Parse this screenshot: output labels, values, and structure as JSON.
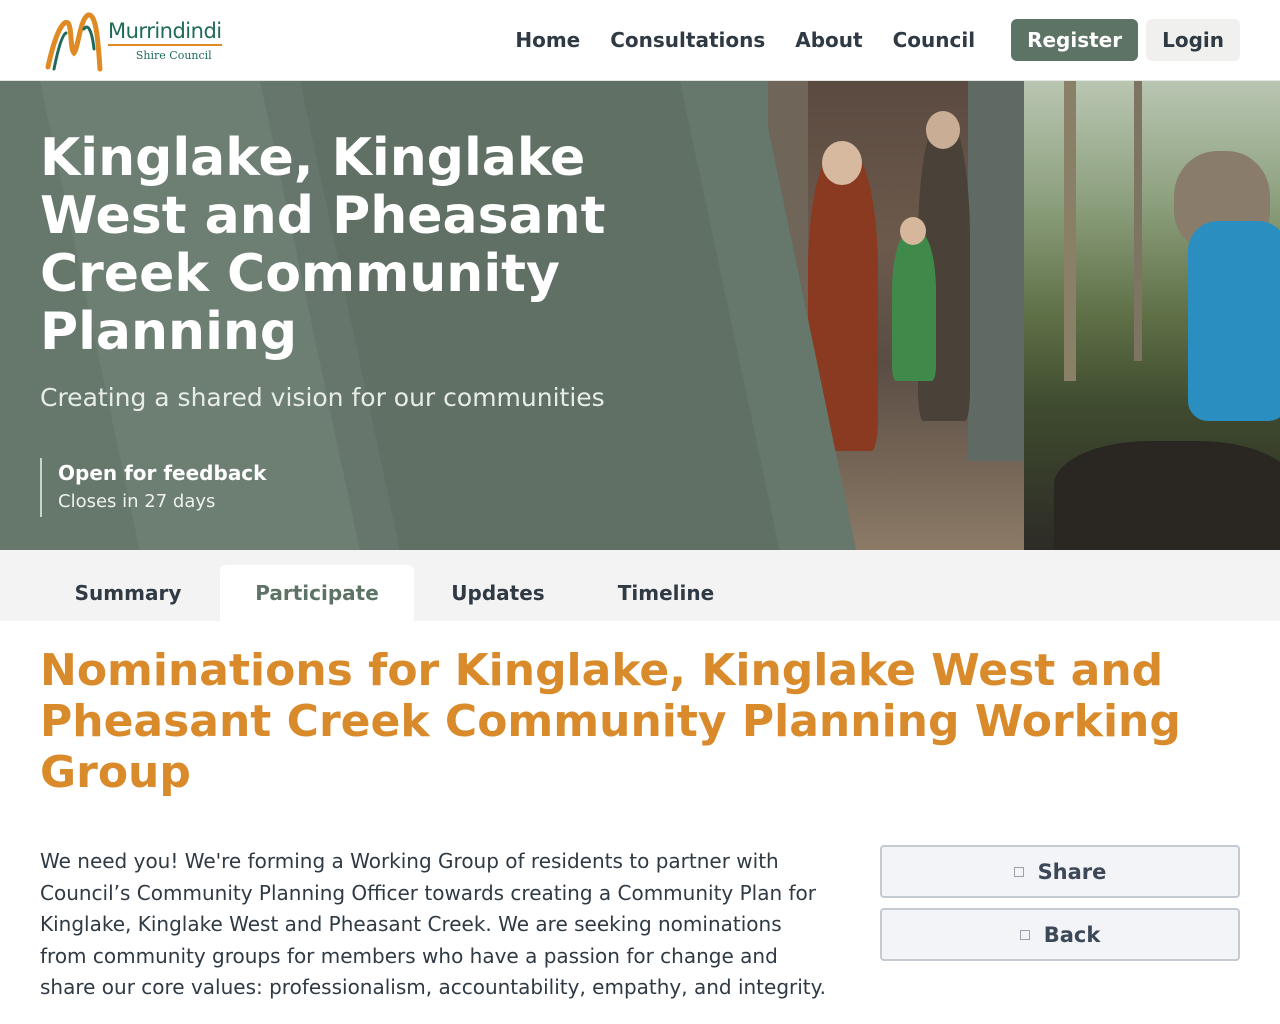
{
  "brand": {
    "name": "Murrindindi",
    "sub": "Shire Council"
  },
  "nav": {
    "items": [
      "Home",
      "Consultations",
      "About",
      "Council"
    ],
    "register": "Register",
    "login": "Login"
  },
  "hero": {
    "title": "Kinglake, Kinglake West and Pheasant Creek Community Planning",
    "subtitle": "Creating a shared vision for our communities",
    "status_title": "Open for feedback",
    "status_sub": "Closes in 27 days"
  },
  "tabs": {
    "items": [
      "Summary",
      "Participate",
      "Updates",
      "Timeline"
    ],
    "active": "Participate"
  },
  "main": {
    "heading": "Nominations for Kinglake, Kinglake West and Pheasant Creek Community Planning Working Group",
    "body": "We need you! We're forming a Working Group of residents to partner with Council’s Community Planning Officer towards creating a Community Plan for Kinglake, Kinglake West and Pheasant Creek. We are seeking nominations from community groups for members who have a passion for change and share our core values: professionalism, accountability, empathy, and integrity."
  },
  "sidebar": {
    "share": "Share",
    "back": "Back"
  },
  "colors": {
    "accent_green": "#5d7366",
    "hero_bg": "#66786c",
    "heading_orange": "#d98a2b",
    "logo_green": "#1f6a5a"
  },
  "icons": [
    "murrindindi-logo",
    "share-icon",
    "back-icon"
  ]
}
